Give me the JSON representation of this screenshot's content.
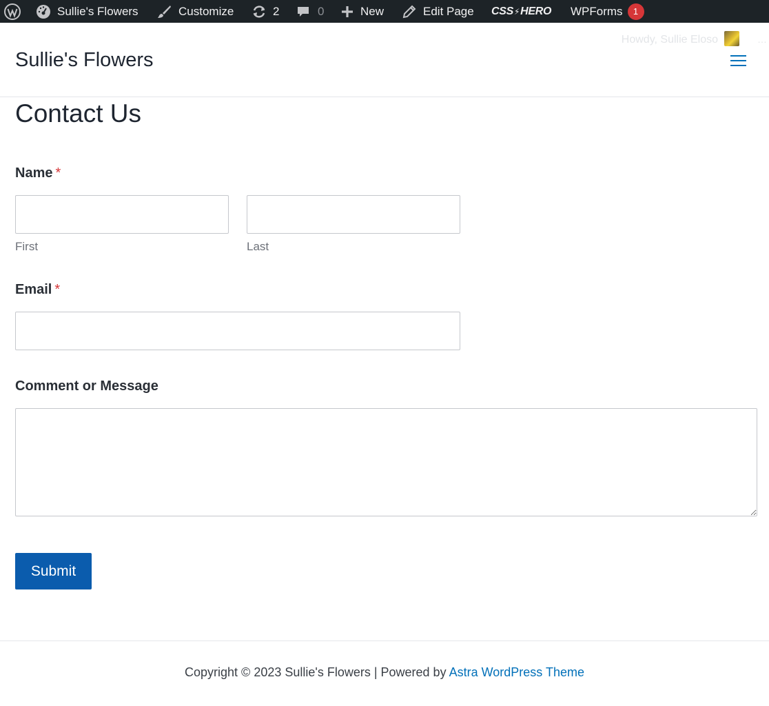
{
  "admin_bar": {
    "items": [
      {
        "id": "wp-logo",
        "icon": "wordpress-icon"
      },
      {
        "id": "site",
        "icon": "dashboard-gauge-icon",
        "label": "Sullie's Flowers"
      },
      {
        "id": "customize",
        "icon": "paintbrush-icon",
        "label": "Customize"
      },
      {
        "id": "updates",
        "icon": "update-arrows-icon",
        "label": "2"
      },
      {
        "id": "comments",
        "icon": "comment-bubble-icon",
        "label": "0"
      },
      {
        "id": "new",
        "icon": "plus-icon",
        "label": "New"
      },
      {
        "id": "edit",
        "icon": "pencil-icon",
        "label": "Edit Page"
      },
      {
        "id": "csshero",
        "label": "CSS HERO"
      },
      {
        "id": "wpforms",
        "label": "WPForms",
        "badge": "1"
      }
    ],
    "howdy": "Howdy, Sullie Eloso",
    "background": "#1d2327"
  },
  "header": {
    "site_title": "Sullie's Flowers",
    "menu_icon": "hamburger-menu-icon"
  },
  "page": {
    "title": "Contact Us"
  },
  "form": {
    "name_label": "Name",
    "required_mark": "*",
    "first_value": "",
    "first_sublabel": "First",
    "last_value": "",
    "last_sublabel": "Last",
    "email_label": "Email",
    "email_value": "",
    "message_label": "Comment or Message",
    "message_value": "",
    "submit_label": "Submit"
  },
  "footer": {
    "copyright": "Copyright © 2023 Sullie's Flowers | Powered by ",
    "link_text": "Astra WordPress Theme"
  },
  "colors": {
    "accent": "#0170b9",
    "button": "#0b5cad",
    "required": "#d63638"
  }
}
